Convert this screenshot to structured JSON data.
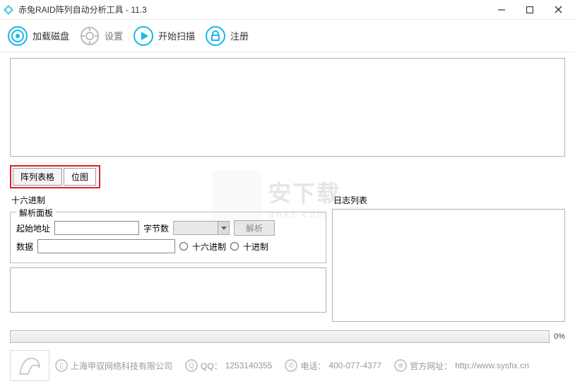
{
  "window": {
    "title": "赤兔RAID阵列自动分析工具 - 11.3"
  },
  "toolbar": {
    "load_disk": "加载磁盘",
    "settings": "设置",
    "start_scan": "开始扫描",
    "register": "注册"
  },
  "tabs": {
    "array_table": "阵列表格",
    "bitmap": "位图"
  },
  "hex": {
    "section_title": "十六进制",
    "panel_legend": "解析面板",
    "start_addr_label": "起始地址",
    "bytes_label": "字节数",
    "parse_btn": "解析",
    "data_label": "数据",
    "radio_hex": "十六进制",
    "radio_dec": "十进制"
  },
  "log": {
    "title": "日志列表"
  },
  "progress": {
    "pct": "0%"
  },
  "footer": {
    "company": "上海甲驭网络科技有限公司",
    "qq_label": "QQ：",
    "qq": "1253140355",
    "tel_label": "电话：",
    "tel": "400-077-4377",
    "site_label": "官方网址：",
    "site": "http://www.sysfix.cn"
  },
  "watermark": {
    "text": "安下载",
    "sub": "anxz.com"
  }
}
